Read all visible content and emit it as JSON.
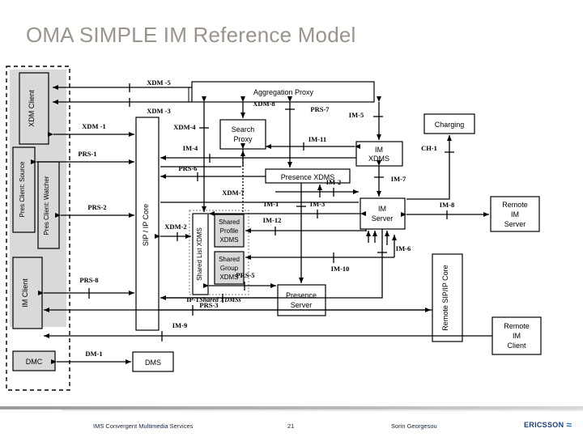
{
  "slide": {
    "title": "OMA SIMPLE IM Reference Model"
  },
  "footer": {
    "subject": "IMS Convergent Multimedia Services",
    "page_number": "21",
    "author": "Sorin Georgesou",
    "brand_name": "ERICSSON",
    "brand_mark": "≈"
  },
  "colors": {
    "title": "#9a948a",
    "box_fill_gray": "#d9d9d9",
    "box_fill_white": "#ffffff",
    "stroke": "#000000",
    "footer_text": "#16233c",
    "brand_blue": "#1b3f73"
  },
  "diagram": {
    "client_domain_label": "",
    "shared_xdms_group_label": "Shared XDMSs",
    "nodes": [
      {
        "id": "xdm-client",
        "label": "XDM Client",
        "orientation": "vertical",
        "fill": "#d9d9d9"
      },
      {
        "id": "pres-client-source",
        "label": "Pres Client: Source",
        "orientation": "vertical",
        "fill": "#d9d9d9"
      },
      {
        "id": "pres-client-watcher",
        "label": "Pres Client: Watcher",
        "orientation": "vertical",
        "fill": "#d9d9d9"
      },
      {
        "id": "im-client",
        "label": "IM Client",
        "orientation": "vertical",
        "fill": "#d9d9d9"
      },
      {
        "id": "dmc",
        "label": "DMC",
        "orientation": "horizontal",
        "fill": "#d9d9d9"
      },
      {
        "id": "sip-ip-core",
        "label": "SIP / IP Core",
        "orientation": "vertical",
        "fill": "#ffffff"
      },
      {
        "id": "dms",
        "label": "DMS",
        "orientation": "horizontal",
        "fill": "#ffffff"
      },
      {
        "id": "aggregation-proxy",
        "label": "Aggregation Proxy",
        "orientation": "horizontal",
        "fill": "#ffffff"
      },
      {
        "id": "search-proxy",
        "label": "Search Proxy",
        "orientation": "horizontal",
        "fill": "#ffffff"
      },
      {
        "id": "presence-xdms",
        "label": "Presence XDMS",
        "orientation": "horizontal",
        "fill": "#ffffff"
      },
      {
        "id": "shared-list-xdms",
        "label": "Shared List XDMS",
        "orientation": "vertical",
        "fill": "#ffffff"
      },
      {
        "id": "shared-profile-xdms",
        "label": "Shared Profile XDMS",
        "orientation": "horizontal",
        "fill": "#ffffff"
      },
      {
        "id": "shared-group-xdms",
        "label": "Shared Group XDMS",
        "orientation": "horizontal",
        "fill": "#ffffff"
      },
      {
        "id": "presence-server",
        "label": "Presence Server",
        "orientation": "horizontal",
        "fill": "#ffffff"
      },
      {
        "id": "im-xdms",
        "label": "IM XDMS",
        "orientation": "horizontal",
        "fill": "#ffffff"
      },
      {
        "id": "im-server",
        "label": "IM Server",
        "orientation": "horizontal",
        "fill": "#ffffff"
      },
      {
        "id": "charging",
        "label": "Charging",
        "orientation": "horizontal",
        "fill": "#ffffff"
      },
      {
        "id": "remote-im-server",
        "label": "Remote IM Server",
        "orientation": "horizontal",
        "fill": "#ffffff"
      },
      {
        "id": "remote-sip-ip-core",
        "label": "Remote SIP/IP Core",
        "orientation": "vertical",
        "fill": "#ffffff"
      },
      {
        "id": "remote-im-client",
        "label": "Remote IM Client",
        "orientation": "horizontal",
        "fill": "#ffffff"
      }
    ],
    "node_labels": {
      "xdm_client": "XDM Client",
      "pres_client_source": "Pres Client: Source",
      "pres_client_watcher": "Pres Client: Watcher",
      "im_client": "IM Client",
      "dmc": "DMC",
      "sip_ip_core": "SIP / IP Core",
      "dms": "DMS",
      "aggregation_proxy": "Aggregation Proxy",
      "search_proxy_l1": "Search",
      "search_proxy_l2": "Proxy",
      "presence_xdms": "Presence XDMS",
      "shared_list_xdms": "Shared List XDMS",
      "shared_profile_l1": "Shared",
      "shared_profile_l2": "Profile",
      "shared_profile_l3": "XDMS",
      "shared_group_l1": "Shared",
      "shared_group_l2": "Group",
      "shared_group_l3": "XDMS",
      "presence_server_l1": "Presence",
      "presence_server_l2": "Server",
      "im_xdms_l1": "IM",
      "im_xdms_l2": "XDMS",
      "im_server_l1": "IM",
      "im_server_l2": "Server",
      "charging": "Charging",
      "remote_im_server_l1": "Remote",
      "remote_im_server_l2": "IM",
      "remote_im_server_l3": "Server",
      "remote_sip_ip_core": "Remote SIP/IP Core",
      "remote_im_client_l1": "Remote",
      "remote_im_client_l2": "IM",
      "remote_im_client_l3": "Client",
      "shared_xdmss_group": "Shared XDMSs"
    },
    "interface_labels": [
      {
        "id": "xdm-5",
        "text": "XDM -5"
      },
      {
        "id": "xdm-3",
        "text": "XDM -3"
      },
      {
        "id": "xdm-1",
        "text": "XDM -1"
      },
      {
        "id": "xdm-8",
        "text": "XDM-8"
      },
      {
        "id": "xdm-4",
        "text": "XDM-4"
      },
      {
        "id": "xdm-7",
        "text": "XDM-7"
      },
      {
        "id": "xdm-2",
        "text": "XDM-2"
      },
      {
        "id": "prs-1",
        "text": "PRS-1"
      },
      {
        "id": "prs-2",
        "text": "PRS-2"
      },
      {
        "id": "prs-3",
        "text": "PRS-3"
      },
      {
        "id": "prs-5",
        "text": "PRS-5"
      },
      {
        "id": "prs-6",
        "text": "PRS-6"
      },
      {
        "id": "prs-7",
        "text": "PRS-7"
      },
      {
        "id": "prs-8",
        "text": "PRS-8"
      },
      {
        "id": "im-1",
        "text": "IM-1"
      },
      {
        "id": "im-2",
        "text": "IM-2"
      },
      {
        "id": "im-3",
        "text": "IM-3"
      },
      {
        "id": "im-4",
        "text": "IM-4"
      },
      {
        "id": "im-5",
        "text": "IM-5"
      },
      {
        "id": "im-6",
        "text": "IM-6"
      },
      {
        "id": "im-7",
        "text": "IM-7"
      },
      {
        "id": "im-8",
        "text": "IM-8"
      },
      {
        "id": "im-9",
        "text": "IM-9"
      },
      {
        "id": "im-10",
        "text": "IM-10"
      },
      {
        "id": "im-11",
        "text": "IM-11"
      },
      {
        "id": "im-12",
        "text": "IM-12"
      },
      {
        "id": "ch-1",
        "text": "CH-1"
      },
      {
        "id": "ip-1",
        "text": "IP-1"
      },
      {
        "id": "dm-1",
        "text": "DM-1"
      }
    ]
  }
}
